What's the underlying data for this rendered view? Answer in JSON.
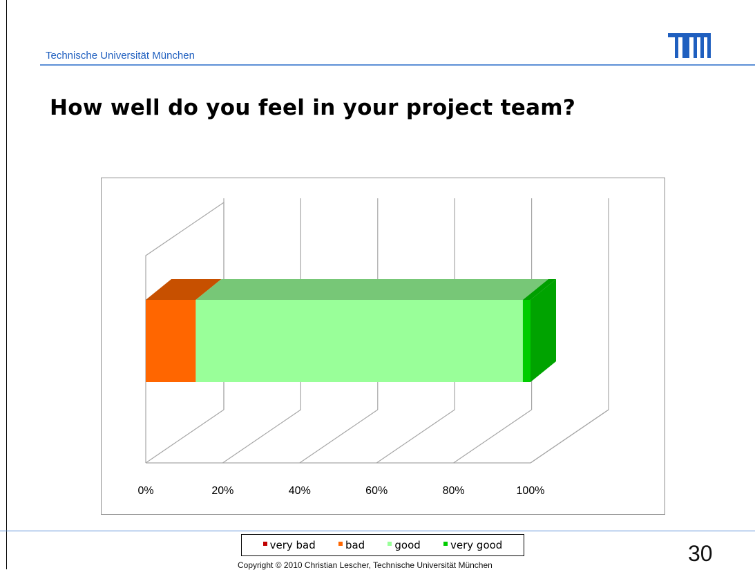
{
  "header": {
    "university": "Technische Universität München",
    "logo_text": "TUM"
  },
  "slide": {
    "title": "How well do you feel in your project team?",
    "page_number": "30",
    "copyright": "Copyright © 2010 Christian Lescher, Technische Universität München"
  },
  "chart_data": {
    "type": "bar",
    "orientation": "horizontal",
    "stacked": true,
    "percent_stacked": true,
    "three_d": true,
    "categories": [
      ""
    ],
    "series": [
      {
        "name": "very bad",
        "values": [
          0
        ],
        "color": "#c00000"
      },
      {
        "name": "bad",
        "values": [
          13
        ],
        "color": "#ff6600"
      },
      {
        "name": "good",
        "values": [
          85
        ],
        "color": "#99ff99"
      },
      {
        "name": "very good",
        "values": [
          2
        ],
        "color": "#00cc00"
      }
    ],
    "xlim": [
      0,
      100
    ],
    "x_ticks": [
      "0%",
      "20%",
      "40%",
      "60%",
      "80%",
      "100%"
    ],
    "grid": true,
    "legend": "bottom"
  }
}
